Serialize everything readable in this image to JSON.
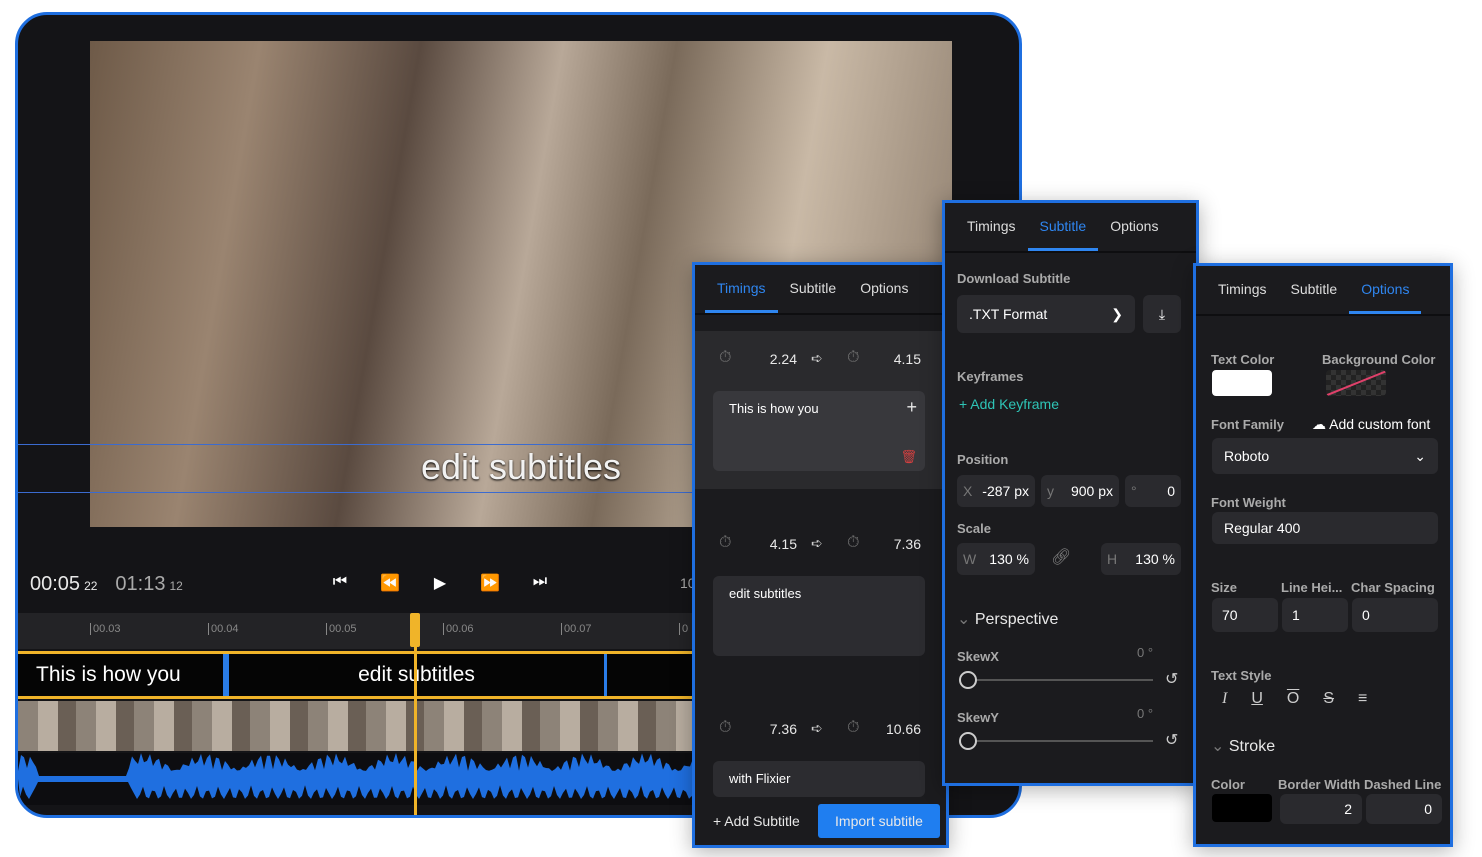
{
  "player": {
    "subtitle_overlay": "edit subtitles",
    "current_time": "00:05",
    "current_frames": "22",
    "total_time": "01:13",
    "total_frames": "12",
    "cut_off_label": "10"
  },
  "controls": [
    {
      "icon": "skip-back-icon",
      "glyph": "⏮"
    },
    {
      "icon": "rewind-icon",
      "glyph": "⏪"
    },
    {
      "icon": "play-icon",
      "glyph": "▶"
    },
    {
      "icon": "fast-forward-icon",
      "glyph": "⏩"
    },
    {
      "icon": "skip-forward-icon",
      "glyph": "⏭"
    }
  ],
  "ruler": [
    "00.03",
    "00.04",
    "00.05",
    "00.06",
    "00.07",
    "0"
  ],
  "track": [
    "This is how you",
    "edit subtitles"
  ],
  "timings_panel": {
    "tabs": [
      "Timings",
      "Subtitle",
      "Options"
    ],
    "active": "Timings",
    "items": [
      {
        "start": "2.24",
        "end": "4.15",
        "text": "This is how you"
      },
      {
        "start": "4.15",
        "end": "7.36",
        "text": "edit subtitles"
      },
      {
        "start": "7.36",
        "end": "10.66",
        "text": "with Flixier"
      }
    ],
    "add_label": "+ Add Subtitle",
    "import_label": "Import subtitle"
  },
  "subtitle_panel": {
    "tabs": [
      "Timings",
      "Subtitle",
      "Options"
    ],
    "active": "Subtitle",
    "download_label": "Download Subtitle",
    "format": ".TXT Format",
    "keyframes_label": "Keyframes",
    "add_keyframe": "Add Keyframe",
    "position_label": "Position",
    "x_prefix": "X",
    "x": "-287 px",
    "y_prefix": "y",
    "y": "900 px",
    "rot_prefix": "°",
    "rotation": "0",
    "scale_label": "Scale",
    "w_prefix": "W",
    "w": "130 %",
    "h_prefix": "H",
    "h": "130 %",
    "perspective_label": "Perspective",
    "skewx_label": "SkewX",
    "skewx": "0 °",
    "skewy_label": "SkewY",
    "skewy": "0 °",
    "skewx_value": 0,
    "skewy_value": 0
  },
  "options_panel": {
    "tabs": [
      "Timings",
      "Subtitle",
      "Options"
    ],
    "active": "Options",
    "text_color_label": "Text Color",
    "text_color": "#ffffff",
    "bg_color_label": "Background Color",
    "font_family_label": "Font Family",
    "add_font": "Add custom font",
    "font_family": "Roboto",
    "font_weight_label": "Font Weight",
    "font_weight": "Regular 400",
    "size_label": "Size",
    "size": "70",
    "line_height_label": "Line Hei...",
    "line_height": "1",
    "char_spacing_label": "Char Spacing",
    "char_spacing": "0",
    "text_style_label": "Text Style",
    "stroke_label": "Stroke",
    "stroke_color_label": "Color",
    "stroke_color": "#000000",
    "border_width_label": "Border Width",
    "border_width": "2",
    "dashed_label": "Dashed Line",
    "dashed": "0"
  },
  "colors": {
    "accent": "#1f6fe0",
    "playhead": "#f0b429",
    "keyframe": "#2ec4b6"
  }
}
